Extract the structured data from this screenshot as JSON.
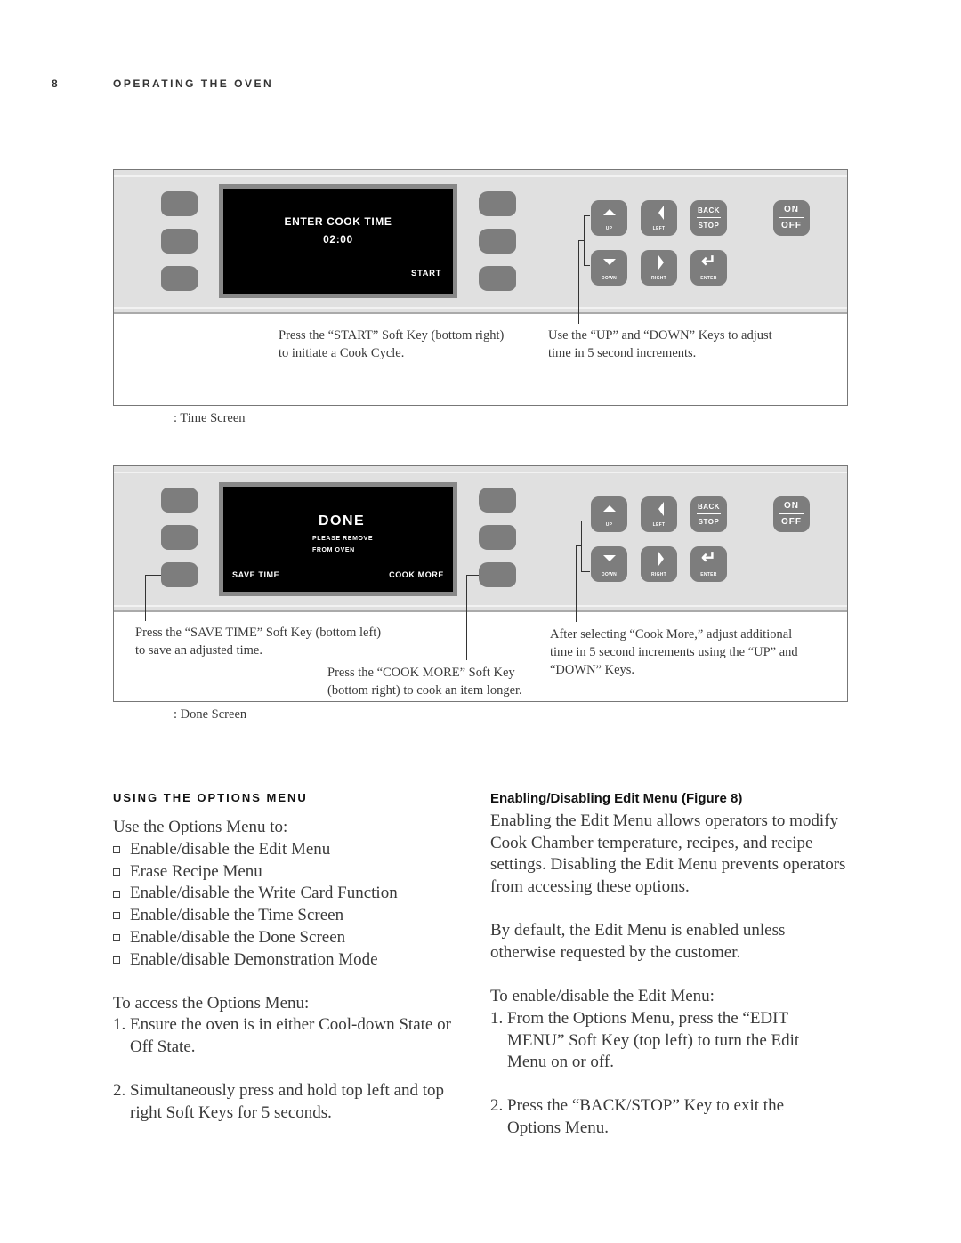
{
  "header": {
    "page_number": "8",
    "section_title": "OPERATING THE OVEN"
  },
  "figures": [
    {
      "id": "time-screen",
      "screen": {
        "lines": [
          "ENTER COOK TIME",
          "02:00"
        ],
        "bottom_left": "",
        "bottom_right": "START"
      },
      "keys": {
        "up": "UP",
        "left": "LEFT",
        "back": "BACK",
        "stop": "STOP",
        "down": "DOWN",
        "right": "RIGHT",
        "enter": "ENTER",
        "on": "ON",
        "off": "OFF"
      },
      "callouts": [
        "Press the “START” Soft Key (bottom right)\nto initiate a Cook Cycle.",
        "Use the “UP” and “DOWN” Keys to adjust\ntime in 5 second increments."
      ],
      "caption": ": Time Screen"
    },
    {
      "id": "done-screen",
      "screen": {
        "title": "DONE",
        "lines": [
          "PLEASE REMOVE",
          "FROM OVEN"
        ],
        "bottom_left": "SAVE TIME",
        "bottom_right": "COOK MORE"
      },
      "keys": {
        "up": "UP",
        "left": "LEFT",
        "back": "BACK",
        "stop": "STOP",
        "down": "DOWN",
        "right": "RIGHT",
        "enter": "ENTER",
        "on": "ON",
        "off": "OFF"
      },
      "callouts": [
        "Press the “SAVE TIME” Soft Key (bottom left)\nto save an adjusted time.",
        "Press the “COOK MORE” Soft Key\n(bottom right) to cook an item longer.",
        "After selecting “Cook More,” adjust additional\ntime in 5 second increments using the “UP” and\n“DOWN” Keys."
      ],
      "caption": ": Done Screen"
    }
  ],
  "left_column": {
    "heading": "USING THE OPTIONS MENU",
    "intro": "Use the Options Menu to:",
    "bullets": [
      "Enable/disable the Edit Menu",
      "Erase Recipe Menu",
      "Enable/disable the Write Card Function",
      "Enable/disable the Time Screen",
      "Enable/disable the Done Screen",
      "Enable/disable Demonstration Mode"
    ],
    "access_intro": "To access the Options Menu:",
    "steps": [
      {
        "n": "1.",
        "text": "Ensure the oven is in either Cool-down State or\nOff State."
      },
      {
        "n": "2.",
        "text": "Simultaneously press and hold top left and top\nright Soft Keys for 5 seconds."
      }
    ]
  },
  "right_column": {
    "heading": "Enabling/Disabling Edit Menu (Figure 8)",
    "para1": "Enabling the Edit Menu allows operators to modify\nCook Chamber temperature, recipes, and recipe\nsettings. Disabling the Edit Menu prevents operators\nfrom accessing these options.",
    "para2": "By default, the Edit Menu is enabled unless\notherwise requested by the customer.",
    "steps_intro": "To enable/disable the Edit Menu:",
    "steps": [
      {
        "n": "1.",
        "text": "From the Options Menu, press the “EDIT\nMENU” Soft Key (top left) to turn the Edit\nMenu on or off."
      },
      {
        "n": "2.",
        "text": "Press the “BACK/STOP” Key to exit the\nOptions Menu."
      }
    ]
  }
}
